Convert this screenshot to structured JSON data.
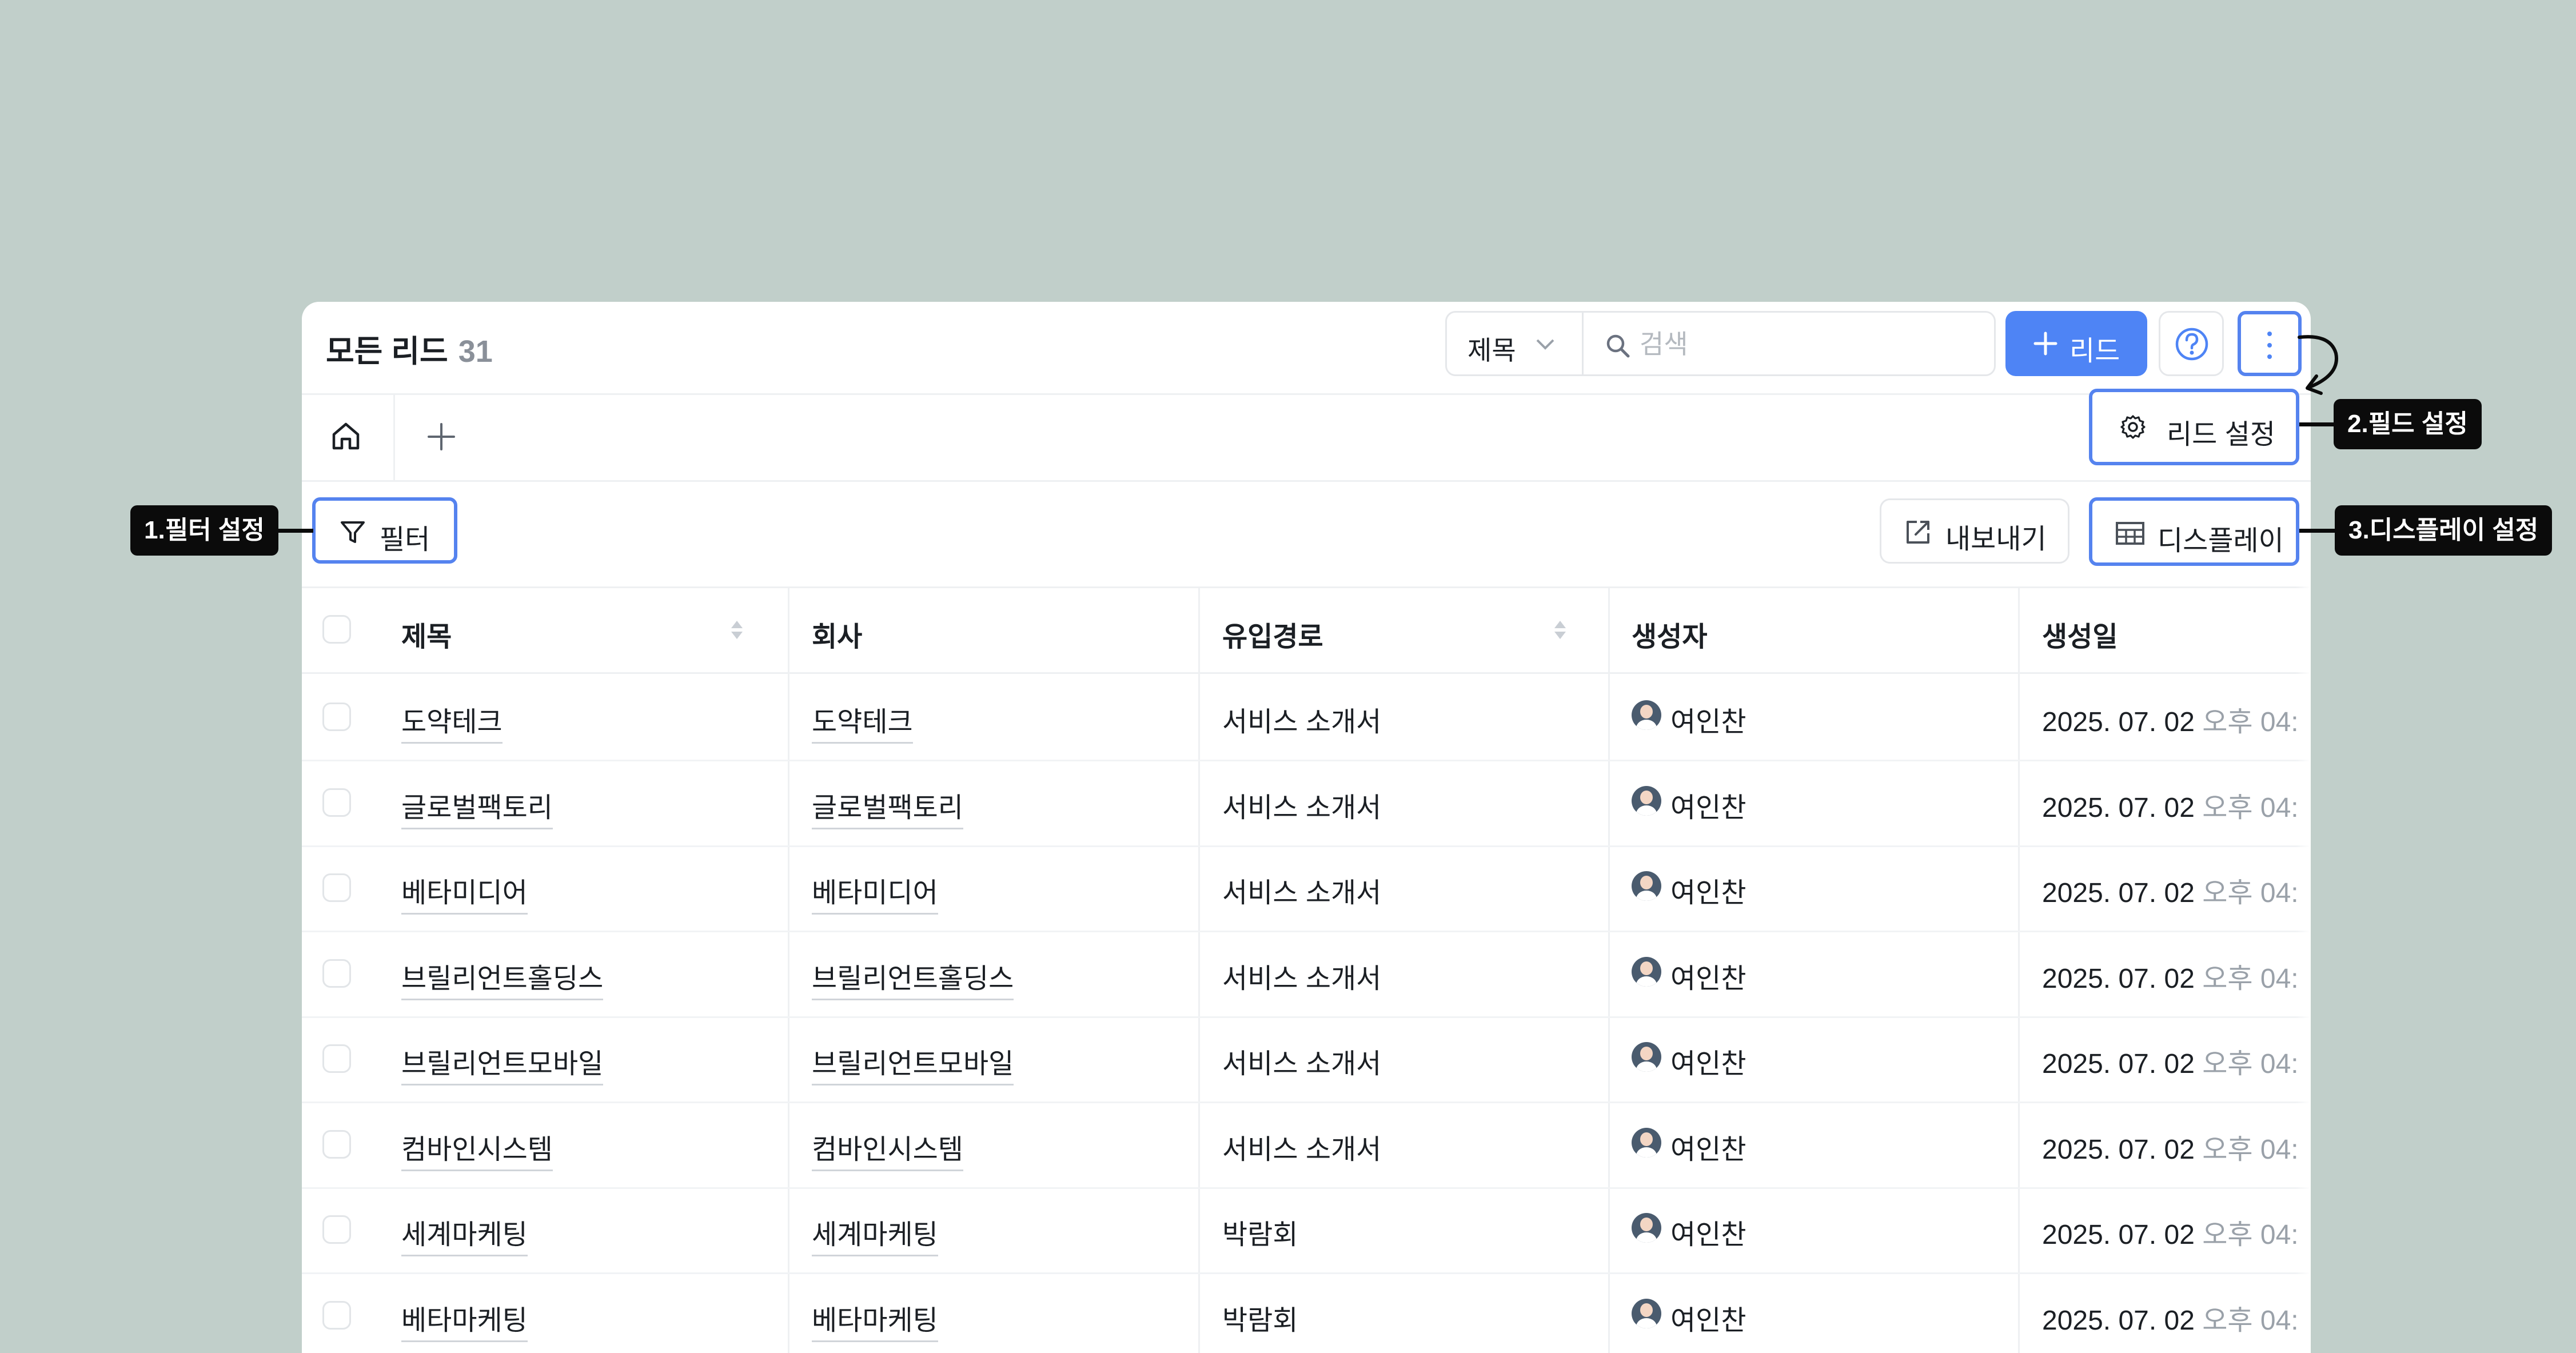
{
  "header": {
    "title": "모든 리드",
    "count": "31",
    "field_select": "제목",
    "search_placeholder": "검색",
    "add_button": "리드"
  },
  "menu": {
    "lead_settings": "리드 설정"
  },
  "toolbar": {
    "filter": "필터",
    "export": "내보내기",
    "display": "디스플레이"
  },
  "table": {
    "columns": [
      "제목",
      "회사",
      "유입경로",
      "생성자",
      "생성일"
    ],
    "rows": [
      {
        "title": "도약테크",
        "company": "도약테크",
        "source": "서비스 소개서",
        "creator": "여인찬",
        "date": "2025. 07. 02",
        "time": "오후 04:"
      },
      {
        "title": "글로벌팩토리",
        "company": "글로벌팩토리",
        "source": "서비스 소개서",
        "creator": "여인찬",
        "date": "2025. 07. 02",
        "time": "오후 04:"
      },
      {
        "title": "베타미디어",
        "company": "베타미디어",
        "source": "서비스 소개서",
        "creator": "여인찬",
        "date": "2025. 07. 02",
        "time": "오후 04:"
      },
      {
        "title": "브릴리언트홀딩스",
        "company": "브릴리언트홀딩스",
        "source": "서비스 소개서",
        "creator": "여인찬",
        "date": "2025. 07. 02",
        "time": "오후 04:"
      },
      {
        "title": "브릴리언트모바일",
        "company": "브릴리언트모바일",
        "source": "서비스 소개서",
        "creator": "여인찬",
        "date": "2025. 07. 02",
        "time": "오후 04:"
      },
      {
        "title": "컴바인시스템",
        "company": "컴바인시스템",
        "source": "서비스 소개서",
        "creator": "여인찬",
        "date": "2025. 07. 02",
        "time": "오후 04:"
      },
      {
        "title": "세계마케팅",
        "company": "세계마케팅",
        "source": "박람회",
        "creator": "여인찬",
        "date": "2025. 07. 02",
        "time": "오후 04:"
      },
      {
        "title": "베타마케팅",
        "company": "베타마케팅",
        "source": "박람회",
        "creator": "여인찬",
        "date": "2025. 07. 02",
        "time": "오후 04:"
      }
    ]
  },
  "callouts": {
    "filter": "1.필터 설정",
    "field": "2.필드 설정",
    "display": "3.디스플레이 설정"
  },
  "colors": {
    "accent": "#4e84f5",
    "highlight": "#5583ef",
    "background": "#c1cfca",
    "callout": "#0b0b0b"
  },
  "icons": [
    "chevron-down-icon",
    "search-icon",
    "plus-icon",
    "help-icon",
    "more-vertical-icon",
    "home-icon",
    "gear-icon",
    "filter-icon",
    "export-icon",
    "table-icon",
    "sort-icon",
    "curved-arrow-icon"
  ]
}
